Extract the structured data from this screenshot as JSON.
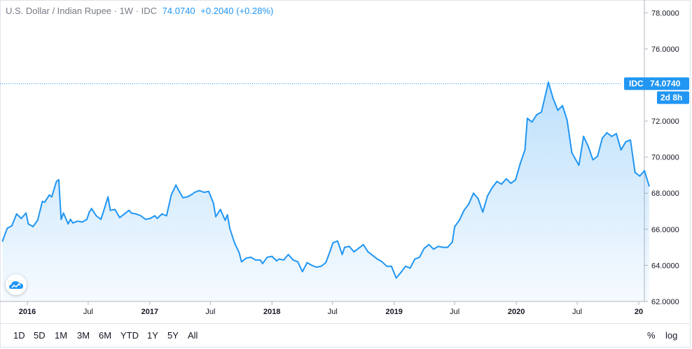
{
  "legend": {
    "symbol": "U.S. Dollar / Indian Rupee · 1W · IDC",
    "price": "74.0740",
    "change": "+0.2040 (+0.28%)"
  },
  "price_label": {
    "source": "IDC",
    "value": "74.0740",
    "countdown": "2d 8h"
  },
  "range_buttons": [
    "1D",
    "5D",
    "1M",
    "3M",
    "6M",
    "YTD",
    "1Y",
    "5Y",
    "All"
  ],
  "scale_buttons": {
    "percent": "%",
    "log": "log"
  },
  "colors": {
    "line": "#2196f3",
    "fill": "#2196f3",
    "label_bg": "#2196f3"
  },
  "chart_data": {
    "type": "area",
    "title": "",
    "xlabel": "",
    "ylabel": "",
    "ylim": [
      62,
      78.4
    ],
    "y_ticks": [
      "62.0000",
      "64.0000",
      "66.0000",
      "68.0000",
      "70.0000",
      "72.0000",
      "74.0000",
      "76.0000",
      "78.0000"
    ],
    "x_ticks": [
      {
        "label": "2016",
        "date": "2016-01-01",
        "bold": true
      },
      {
        "label": "Jul",
        "date": "2016-07-01",
        "bold": false
      },
      {
        "label": "2017",
        "date": "2017-01-01",
        "bold": true
      },
      {
        "label": "Jul",
        "date": "2017-07-01",
        "bold": false
      },
      {
        "label": "2018",
        "date": "2018-01-01",
        "bold": true
      },
      {
        "label": "Jul",
        "date": "2018-07-01",
        "bold": false
      },
      {
        "label": "2019",
        "date": "2019-01-01",
        "bold": true
      },
      {
        "label": "Jul",
        "date": "2019-07-01",
        "bold": false
      },
      {
        "label": "2020",
        "date": "2020-01-01",
        "bold": true
      },
      {
        "label": "Jul",
        "date": "2020-07-01",
        "bold": false
      },
      {
        "label": "20",
        "date": "2021-01-01",
        "bold": true
      }
    ],
    "series": [
      {
        "points": [
          [
            "2015-10-19",
            65.35
          ],
          [
            "2015-11-02",
            66.05
          ],
          [
            "2015-11-16",
            66.2
          ],
          [
            "2015-11-30",
            66.85
          ],
          [
            "2015-12-14",
            66.6
          ],
          [
            "2015-12-28",
            66.9
          ],
          [
            "2016-01-04",
            66.3
          ],
          [
            "2016-01-18",
            66.15
          ],
          [
            "2016-02-01",
            66.5
          ],
          [
            "2016-02-15",
            67.55
          ],
          [
            "2016-02-22",
            67.5
          ],
          [
            "2016-03-07",
            67.9
          ],
          [
            "2016-03-14",
            67.8
          ],
          [
            "2016-03-28",
            68.65
          ],
          [
            "2016-04-04",
            68.75
          ],
          [
            "2016-04-11",
            66.55
          ],
          [
            "2016-04-18",
            66.9
          ],
          [
            "2016-05-02",
            66.3
          ],
          [
            "2016-05-09",
            66.55
          ],
          [
            "2016-05-16",
            66.35
          ],
          [
            "2016-05-30",
            66.45
          ],
          [
            "2016-06-13",
            66.4
          ],
          [
            "2016-06-27",
            66.55
          ],
          [
            "2016-07-04",
            66.95
          ],
          [
            "2016-07-11",
            67.15
          ],
          [
            "2016-07-25",
            66.75
          ],
          [
            "2016-08-08",
            66.55
          ],
          [
            "2016-08-15",
            66.95
          ],
          [
            "2016-08-29",
            67.8
          ],
          [
            "2016-09-05",
            67.05
          ],
          [
            "2016-09-19",
            67.1
          ],
          [
            "2016-10-03",
            66.65
          ],
          [
            "2016-10-17",
            66.85
          ],
          [
            "2016-10-31",
            67.05
          ],
          [
            "2016-11-07",
            66.9
          ],
          [
            "2016-11-21",
            66.85
          ],
          [
            "2016-12-05",
            66.75
          ],
          [
            "2016-12-19",
            66.55
          ],
          [
            "2017-01-02",
            66.6
          ],
          [
            "2017-01-16",
            66.75
          ],
          [
            "2017-01-23",
            66.6
          ],
          [
            "2017-02-06",
            66.85
          ],
          [
            "2017-02-20",
            66.75
          ],
          [
            "2017-03-06",
            67.9
          ],
          [
            "2017-03-20",
            68.45
          ],
          [
            "2017-03-27",
            68.2
          ],
          [
            "2017-04-10",
            67.75
          ],
          [
            "2017-04-24",
            67.8
          ],
          [
            "2017-05-08",
            67.95
          ],
          [
            "2017-05-15",
            68.05
          ],
          [
            "2017-05-29",
            68.15
          ],
          [
            "2017-06-12",
            68.05
          ],
          [
            "2017-06-26",
            68.1
          ],
          [
            "2017-07-10",
            67.45
          ],
          [
            "2017-07-17",
            66.7
          ],
          [
            "2017-07-31",
            67.1
          ],
          [
            "2017-08-14",
            66.5
          ],
          [
            "2017-08-21",
            66.8
          ],
          [
            "2017-08-28",
            66.05
          ],
          [
            "2017-09-11",
            65.25
          ],
          [
            "2017-09-25",
            64.7
          ],
          [
            "2017-10-02",
            64.2
          ],
          [
            "2017-10-16",
            64.4
          ],
          [
            "2017-10-30",
            64.45
          ],
          [
            "2017-11-13",
            64.3
          ],
          [
            "2017-11-27",
            64.3
          ],
          [
            "2017-12-04",
            64.1
          ],
          [
            "2017-12-18",
            64.45
          ],
          [
            "2018-01-01",
            64.5
          ],
          [
            "2018-01-15",
            64.25
          ],
          [
            "2018-01-22",
            64.35
          ],
          [
            "2018-02-05",
            64.3
          ],
          [
            "2018-02-19",
            64.6
          ],
          [
            "2018-03-05",
            64.3
          ],
          [
            "2018-03-19",
            64.2
          ],
          [
            "2018-04-02",
            63.65
          ],
          [
            "2018-04-16",
            64.15
          ],
          [
            "2018-04-30",
            64.0
          ],
          [
            "2018-05-14",
            63.9
          ],
          [
            "2018-05-28",
            63.95
          ],
          [
            "2018-06-11",
            64.15
          ],
          [
            "2018-06-25",
            64.85
          ],
          [
            "2018-07-02",
            65.25
          ],
          [
            "2018-07-16",
            65.35
          ],
          [
            "2018-07-30",
            64.6
          ],
          [
            "2018-08-06",
            65.0
          ],
          [
            "2018-08-20",
            65.05
          ],
          [
            "2018-09-03",
            64.75
          ],
          [
            "2018-09-17",
            64.95
          ],
          [
            "2018-10-01",
            65.15
          ],
          [
            "2018-10-15",
            64.75
          ],
          [
            "2018-10-29",
            64.55
          ],
          [
            "2018-11-12",
            64.35
          ],
          [
            "2018-11-26",
            64.2
          ],
          [
            "2018-12-10",
            63.95
          ],
          [
            "2018-12-24",
            63.95
          ],
          [
            "2019-01-07",
            63.3
          ],
          [
            "2019-01-21",
            63.6
          ],
          [
            "2019-02-04",
            63.95
          ],
          [
            "2019-02-18",
            63.85
          ],
          [
            "2019-03-04",
            64.35
          ],
          [
            "2019-03-18",
            64.45
          ],
          [
            "2019-04-01",
            64.95
          ],
          [
            "2019-04-15",
            65.15
          ],
          [
            "2019-04-29",
            64.9
          ],
          [
            "2019-05-13",
            65.05
          ],
          [
            "2019-05-27",
            65.0
          ],
          [
            "2019-06-10",
            65.0
          ],
          [
            "2019-06-24",
            65.3
          ],
          [
            "2019-07-01",
            66.15
          ],
          [
            "2019-07-15",
            66.5
          ],
          [
            "2019-07-29",
            67.05
          ],
          [
            "2019-08-12",
            67.4
          ],
          [
            "2019-08-26",
            68.0
          ],
          [
            "2019-09-09",
            67.7
          ],
          [
            "2019-09-23",
            66.95
          ],
          [
            "2019-10-07",
            67.85
          ],
          [
            "2019-10-21",
            68.3
          ],
          [
            "2019-11-04",
            68.65
          ],
          [
            "2019-11-18",
            68.5
          ],
          [
            "2019-12-02",
            68.8
          ],
          [
            "2019-12-16",
            68.55
          ],
          [
            "2019-12-30",
            68.75
          ],
          [
            "2020-01-13",
            69.65
          ],
          [
            "2020-01-27",
            70.4
          ],
          [
            "2020-02-03",
            72.15
          ],
          [
            "2020-02-17",
            71.95
          ],
          [
            "2020-03-02",
            72.35
          ],
          [
            "2020-03-16",
            72.5
          ],
          [
            "2020-04-06",
            74.15
          ],
          [
            "2020-04-20",
            73.25
          ],
          [
            "2020-05-04",
            72.6
          ],
          [
            "2020-05-18",
            72.85
          ],
          [
            "2020-06-01",
            72.05
          ],
          [
            "2020-06-15",
            70.25
          ],
          [
            "2020-07-06",
            69.55
          ],
          [
            "2020-07-20",
            71.15
          ],
          [
            "2020-08-03",
            70.6
          ],
          [
            "2020-08-17",
            69.85
          ],
          [
            "2020-08-31",
            70.05
          ],
          [
            "2020-09-14",
            71.05
          ],
          [
            "2020-09-28",
            71.35
          ],
          [
            "2020-10-12",
            71.15
          ],
          [
            "2020-10-26",
            71.3
          ],
          [
            "2020-11-09",
            70.4
          ],
          [
            "2020-11-23",
            70.85
          ],
          [
            "2020-12-07",
            70.95
          ],
          [
            "2020-12-21",
            69.15
          ],
          [
            "2021-01-04",
            68.95
          ],
          [
            "2021-01-18",
            69.25
          ],
          [
            "2021-02-01",
            68.4
          ]
        ]
      }
    ]
  }
}
